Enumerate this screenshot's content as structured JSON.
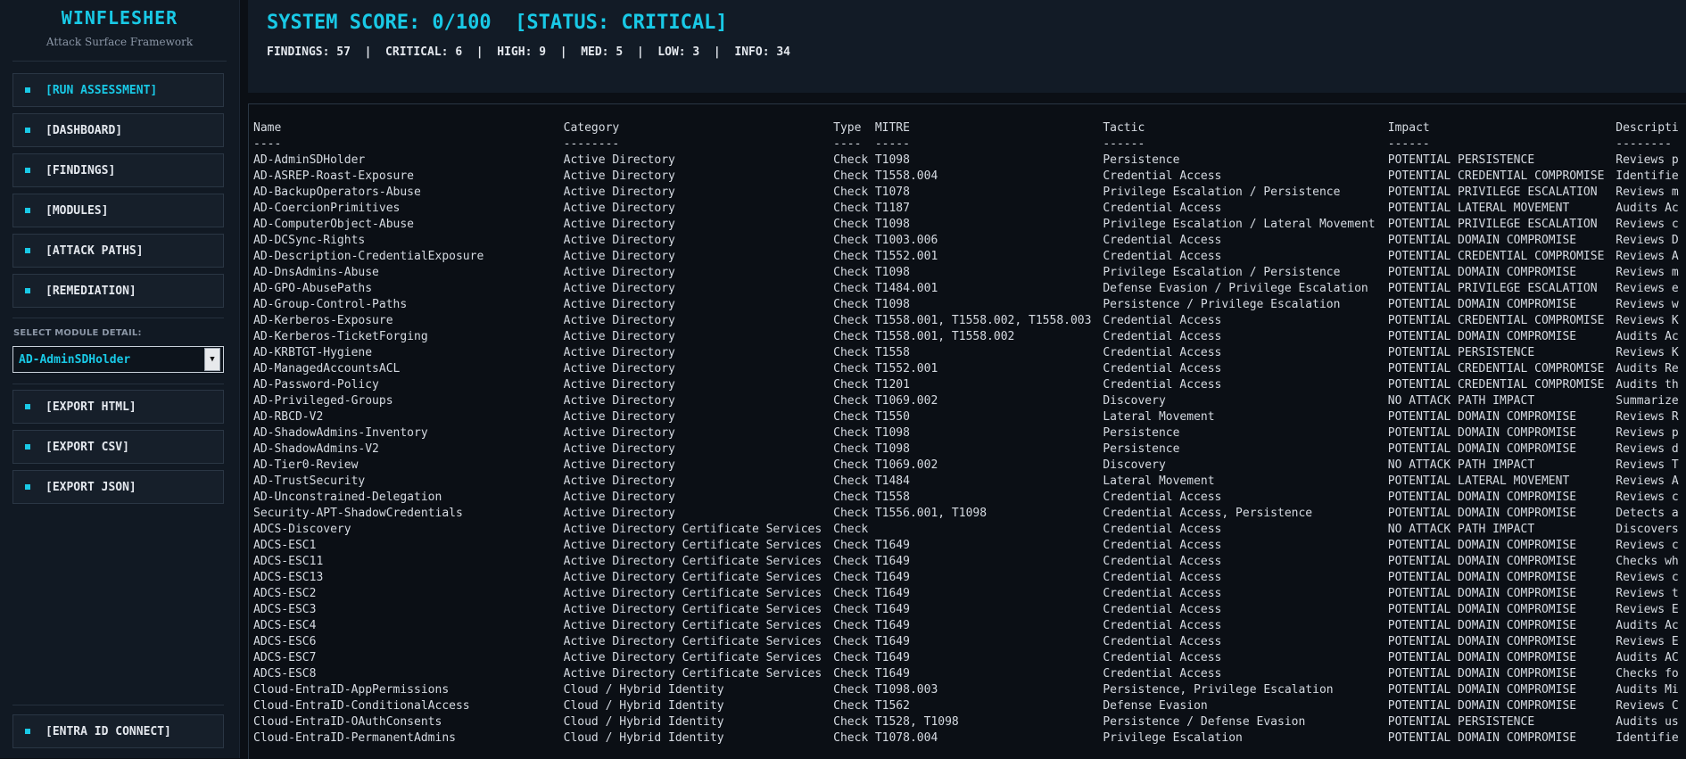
{
  "brand": {
    "title": "WINFLESHER",
    "subtitle": "Attack Surface Framework"
  },
  "nav": {
    "run": "[RUN ASSESSMENT]",
    "dashboard": "[DASHBOARD]",
    "findings": "[FINDINGS]",
    "modules": "[MODULES]",
    "attack_paths": "[ATTACK PATHS]",
    "remediation": "[REMEDIATION]",
    "select_label": "SELECT MODULE DETAIL:",
    "select_value": "AD-AdminSDHolder",
    "export_html": "[EXPORT HTML]",
    "export_csv": "[EXPORT CSV]",
    "export_json": "[EXPORT JSON]",
    "entra": "[ENTRA ID CONNECT]"
  },
  "header": {
    "score": "SYSTEM SCORE: 0/100  [STATUS: CRITICAL]",
    "counts": "FINDINGS: 57  |  CRITICAL: 6  |  HIGH: 9  |  MED: 5  |  LOW: 3  |  INFO: 34"
  },
  "colors": {
    "accent": "#19c9e6",
    "bg": "#0b0f15",
    "panel": "#111923"
  },
  "table": {
    "headers": [
      "Name",
      "Category",
      "Type",
      "MITRE",
      "Tactic",
      "Impact",
      "Descripti"
    ],
    "underlines": [
      "----",
      "--------",
      "----",
      "-----",
      "------",
      "------",
      "--------"
    ],
    "rows": [
      [
        "AD-AdminSDHolder",
        "Active Directory",
        "Check",
        "T1098",
        "Persistence",
        "POTENTIAL PERSISTENCE",
        "Reviews p"
      ],
      [
        "AD-ASREP-Roast-Exposure",
        "Active Directory",
        "Check",
        "T1558.004",
        "Credential Access",
        "POTENTIAL CREDENTIAL COMPROMISE",
        "Identifie"
      ],
      [
        "AD-BackupOperators-Abuse",
        "Active Directory",
        "Check",
        "T1078",
        "Privilege Escalation / Persistence",
        "POTENTIAL PRIVILEGE ESCALATION",
        "Reviews m"
      ],
      [
        "AD-CoercionPrimitives",
        "Active Directory",
        "Check",
        "T1187",
        "Credential Access",
        "POTENTIAL LATERAL MOVEMENT",
        "Audits Ac"
      ],
      [
        "AD-ComputerObject-Abuse",
        "Active Directory",
        "Check",
        "T1098",
        "Privilege Escalation / Lateral Movement",
        "POTENTIAL PRIVILEGE ESCALATION",
        "Reviews c"
      ],
      [
        "AD-DCSync-Rights",
        "Active Directory",
        "Check",
        "T1003.006",
        "Credential Access",
        "POTENTIAL DOMAIN COMPROMISE",
        "Reviews D"
      ],
      [
        "AD-Description-CredentialExposure",
        "Active Directory",
        "Check",
        "T1552.001",
        "Credential Access",
        "POTENTIAL CREDENTIAL COMPROMISE",
        "Reviews A"
      ],
      [
        "AD-DnsAdmins-Abuse",
        "Active Directory",
        "Check",
        "T1098",
        "Privilege Escalation / Persistence",
        "POTENTIAL DOMAIN COMPROMISE",
        "Reviews m"
      ],
      [
        "AD-GPO-AbusePaths",
        "Active Directory",
        "Check",
        "T1484.001",
        "Defense Evasion / Privilege Escalation",
        "POTENTIAL PRIVILEGE ESCALATION",
        "Reviews e"
      ],
      [
        "AD-Group-Control-Paths",
        "Active Directory",
        "Check",
        "T1098",
        "Persistence / Privilege Escalation",
        "POTENTIAL DOMAIN COMPROMISE",
        "Reviews w"
      ],
      [
        "AD-Kerberos-Exposure",
        "Active Directory",
        "Check",
        "T1558.001, T1558.002, T1558.003",
        "Credential Access",
        "POTENTIAL CREDENTIAL COMPROMISE",
        "Reviews K"
      ],
      [
        "AD-Kerberos-TicketForging",
        "Active Directory",
        "Check",
        "T1558.001, T1558.002",
        "Credential Access",
        "POTENTIAL DOMAIN COMPROMISE",
        "Audits Ac"
      ],
      [
        "AD-KRBTGT-Hygiene",
        "Active Directory",
        "Check",
        "T1558",
        "Credential Access",
        "POTENTIAL PERSISTENCE",
        "Reviews K"
      ],
      [
        "AD-ManagedAccountsACL",
        "Active Directory",
        "Check",
        "T1552.001",
        "Credential Access",
        "POTENTIAL CREDENTIAL COMPROMISE",
        "Audits Re"
      ],
      [
        "AD-Password-Policy",
        "Active Directory",
        "Check",
        "T1201",
        "Credential Access",
        "POTENTIAL CREDENTIAL COMPROMISE",
        "Audits th"
      ],
      [
        "AD-Privileged-Groups",
        "Active Directory",
        "Check",
        "T1069.002",
        "Discovery",
        "NO ATTACK PATH IMPACT",
        "Summarize"
      ],
      [
        "AD-RBCD-V2",
        "Active Directory",
        "Check",
        "T1550",
        "Lateral Movement",
        "POTENTIAL DOMAIN COMPROMISE",
        "Reviews R"
      ],
      [
        "AD-ShadowAdmins-Inventory",
        "Active Directory",
        "Check",
        "T1098",
        "Persistence",
        "POTENTIAL DOMAIN COMPROMISE",
        "Reviews p"
      ],
      [
        "AD-ShadowAdmins-V2",
        "Active Directory",
        "Check",
        "T1098",
        "Persistence",
        "POTENTIAL DOMAIN COMPROMISE",
        "Reviews d"
      ],
      [
        "AD-Tier0-Review",
        "Active Directory",
        "Check",
        "T1069.002",
        "Discovery",
        "NO ATTACK PATH IMPACT",
        "Reviews T"
      ],
      [
        "AD-TrustSecurity",
        "Active Directory",
        "Check",
        "T1484",
        "Lateral Movement",
        "POTENTIAL LATERAL MOVEMENT",
        "Reviews A"
      ],
      [
        "AD-Unconstrained-Delegation",
        "Active Directory",
        "Check",
        "T1558",
        "Credential Access",
        "POTENTIAL DOMAIN COMPROMISE",
        "Reviews c"
      ],
      [
        "Security-APT-ShadowCredentials",
        "Active Directory",
        "Check",
        "T1556.001, T1098",
        "Credential Access, Persistence",
        "POTENTIAL DOMAIN COMPROMISE",
        "Detects a"
      ],
      [
        "ADCS-Discovery",
        "Active Directory Certificate Services",
        "Check",
        "",
        "Credential Access",
        "NO ATTACK PATH IMPACT",
        "Discovers"
      ],
      [
        "ADCS-ESC1",
        "Active Directory Certificate Services",
        "Check",
        "T1649",
        "Credential Access",
        "POTENTIAL DOMAIN COMPROMISE",
        "Reviews c"
      ],
      [
        "ADCS-ESC11",
        "Active Directory Certificate Services",
        "Check",
        "T1649",
        "Credential Access",
        "POTENTIAL DOMAIN COMPROMISE",
        "Checks wh"
      ],
      [
        "ADCS-ESC13",
        "Active Directory Certificate Services",
        "Check",
        "T1649",
        "Credential Access",
        "POTENTIAL DOMAIN COMPROMISE",
        "Reviews c"
      ],
      [
        "ADCS-ESC2",
        "Active Directory Certificate Services",
        "Check",
        "T1649",
        "Credential Access",
        "POTENTIAL DOMAIN COMPROMISE",
        "Reviews t"
      ],
      [
        "ADCS-ESC3",
        "Active Directory Certificate Services",
        "Check",
        "T1649",
        "Credential Access",
        "POTENTIAL DOMAIN COMPROMISE",
        "Reviews E"
      ],
      [
        "ADCS-ESC4",
        "Active Directory Certificate Services",
        "Check",
        "T1649",
        "Credential Access",
        "POTENTIAL DOMAIN COMPROMISE",
        "Audits Ac"
      ],
      [
        "ADCS-ESC6",
        "Active Directory Certificate Services",
        "Check",
        "T1649",
        "Credential Access",
        "POTENTIAL DOMAIN COMPROMISE",
        "Reviews E"
      ],
      [
        "ADCS-ESC7",
        "Active Directory Certificate Services",
        "Check",
        "T1649",
        "Credential Access",
        "POTENTIAL DOMAIN COMPROMISE",
        "Audits AC"
      ],
      [
        "ADCS-ESC8",
        "Active Directory Certificate Services",
        "Check",
        "T1649",
        "Credential Access",
        "POTENTIAL DOMAIN COMPROMISE",
        "Checks fo"
      ],
      [
        "Cloud-EntraID-AppPermissions",
        "Cloud / Hybrid Identity",
        "Check",
        "T1098.003",
        "Persistence, Privilege Escalation",
        "POTENTIAL DOMAIN COMPROMISE",
        "Audits Mi"
      ],
      [
        "Cloud-EntraID-ConditionalAccess",
        "Cloud / Hybrid Identity",
        "Check",
        "T1562",
        "Defense Evasion",
        "POTENTIAL DOMAIN COMPROMISE",
        "Reviews C"
      ],
      [
        "Cloud-EntraID-OAuthConsents",
        "Cloud / Hybrid Identity",
        "Check",
        "T1528, T1098",
        "Persistence / Defense Evasion",
        "POTENTIAL PERSISTENCE",
        "Audits us"
      ],
      [
        "Cloud-EntraID-PermanentAdmins",
        "Cloud / Hybrid Identity",
        "Check",
        "T1078.004",
        "Privilege Escalation",
        "POTENTIAL DOMAIN COMPROMISE",
        "Identifie"
      ]
    ]
  }
}
